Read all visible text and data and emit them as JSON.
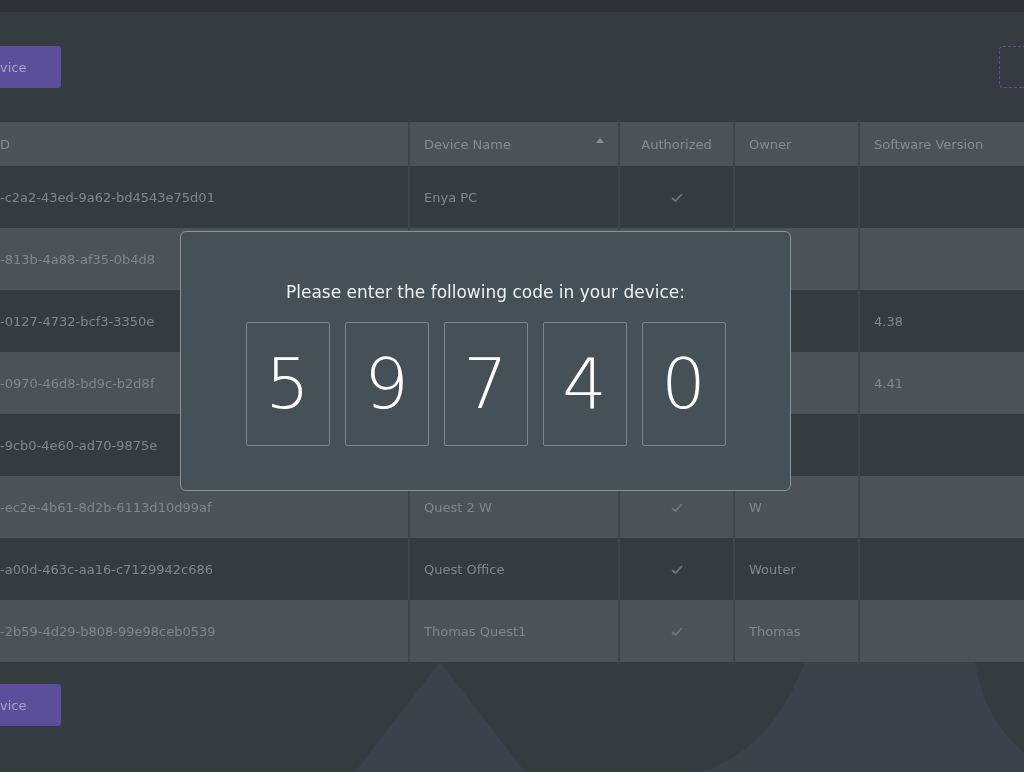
{
  "toolbar": {
    "button": "vice"
  },
  "table": {
    "columns": [
      {
        "label": "D"
      },
      {
        "label": "Device Name",
        "sorted": true
      },
      {
        "label": "Authorized"
      },
      {
        "label": "Owner"
      },
      {
        "label": "Software Version"
      }
    ],
    "rows": [
      {
        "id": "-c2a2-43ed-9a62-bd4543e75d01",
        "name": "Enya PC",
        "authorized": true
      },
      {
        "id": "-813b-4a88-af35-0b4d8"
      },
      {
        "id": "-0127-4732-bcf3-3350e",
        "version": "4.38"
      },
      {
        "id": "-0970-46d8-bd9c-b2d8f",
        "version": "4.41"
      },
      {
        "id": "-9cb0-4e60-ad70-9875e"
      },
      {
        "id": "-ec2e-4b61-8d2b-6113d10d99af",
        "name": "Quest 2 W",
        "authorized": true,
        "owner": "W"
      },
      {
        "id": "-a00d-463c-aa16-c7129942c686",
        "name": "Quest Office",
        "authorized": true,
        "owner": "Wouter"
      },
      {
        "id": "-2b59-4d29-b808-99e98ceb0539",
        "name": "Thomas Quest1",
        "authorized": true,
        "owner": "Thomas"
      }
    ]
  },
  "footer": {
    "button": "vice"
  },
  "dialog": {
    "message": "Please enter the following code in your device:",
    "digits": [
      "5",
      "9",
      "7",
      "4",
      "0"
    ]
  }
}
